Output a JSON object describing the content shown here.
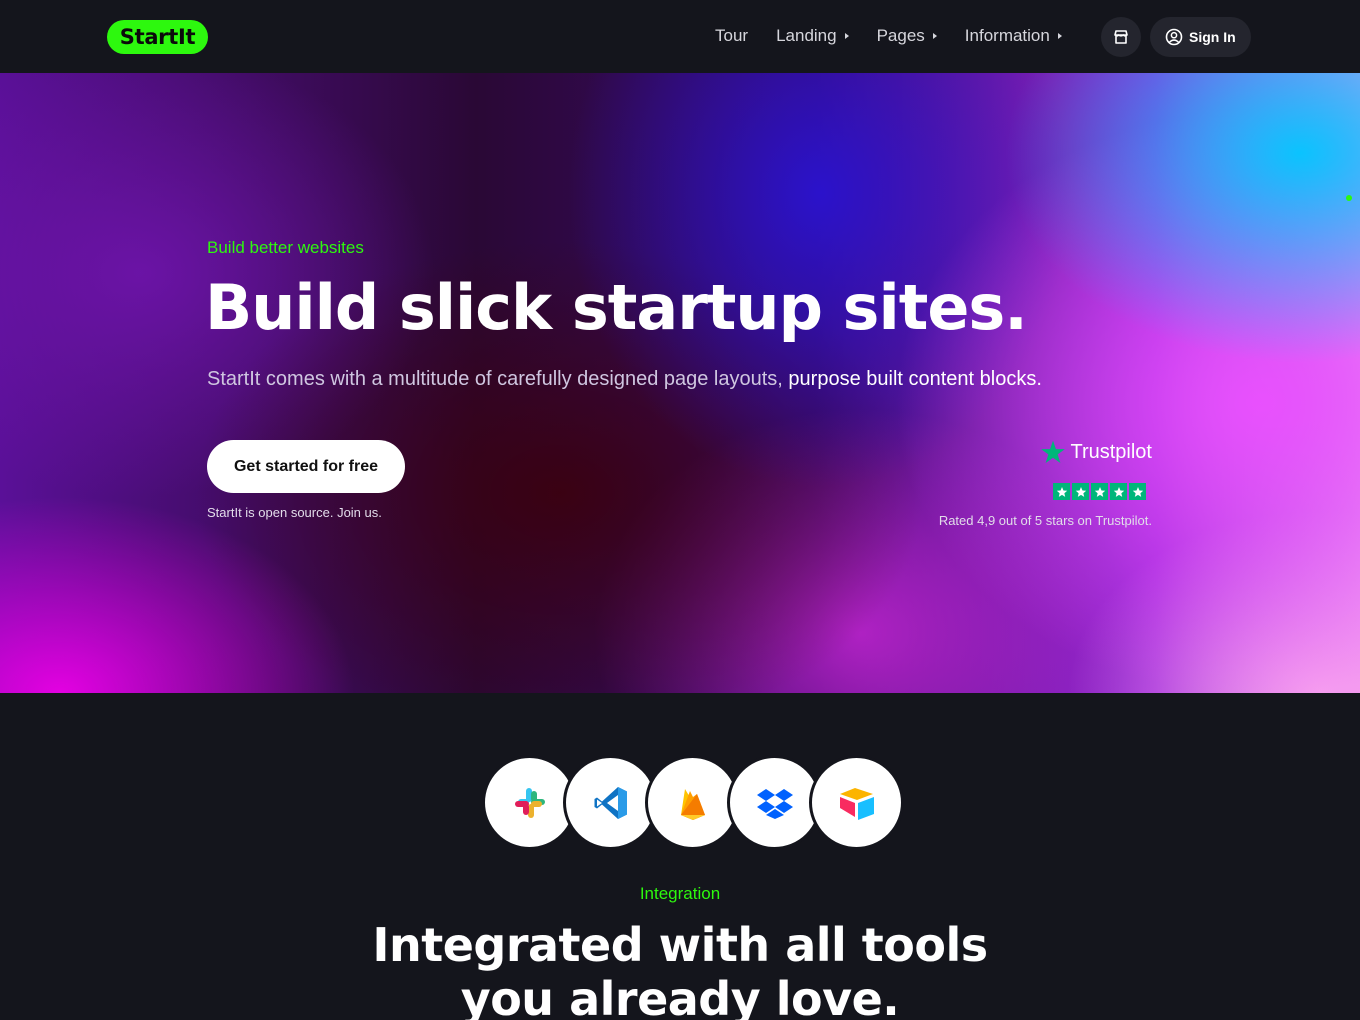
{
  "brand": {
    "logo_text": "StartIt",
    "accent": "#2df80e"
  },
  "nav": {
    "items": [
      {
        "label": "Tour",
        "has_caret": false
      },
      {
        "label": "Landing",
        "has_caret": true
      },
      {
        "label": "Pages",
        "has_caret": true
      },
      {
        "label": "Information",
        "has_caret": true
      }
    ],
    "store_icon": "store-icon",
    "signin_label": "Sign In"
  },
  "hero": {
    "eyebrow": "Build better websites",
    "title": "Build slick startup sites.",
    "subtitle_plain": "StartIt comes with a multitude of carefully designed page layouts,",
    "subtitle_highlight": "purpose built content blocks.",
    "cta_label": "Get started for free",
    "cta_note": "StartIt is open source. Join us.",
    "trustpilot": {
      "brand": "Trustpilot",
      "stars": 5,
      "note": "Rated 4,9 out of 5 stars on Trustpilot.",
      "color": "#00b67a"
    }
  },
  "integration": {
    "logos": [
      "slack-icon",
      "visual-studio-code-icon",
      "firebase-icon",
      "dropbox-icon",
      "airtable-icon"
    ],
    "eyebrow": "Integration",
    "title_line1": "Integrated with all tools",
    "title_line2": "you already love."
  }
}
